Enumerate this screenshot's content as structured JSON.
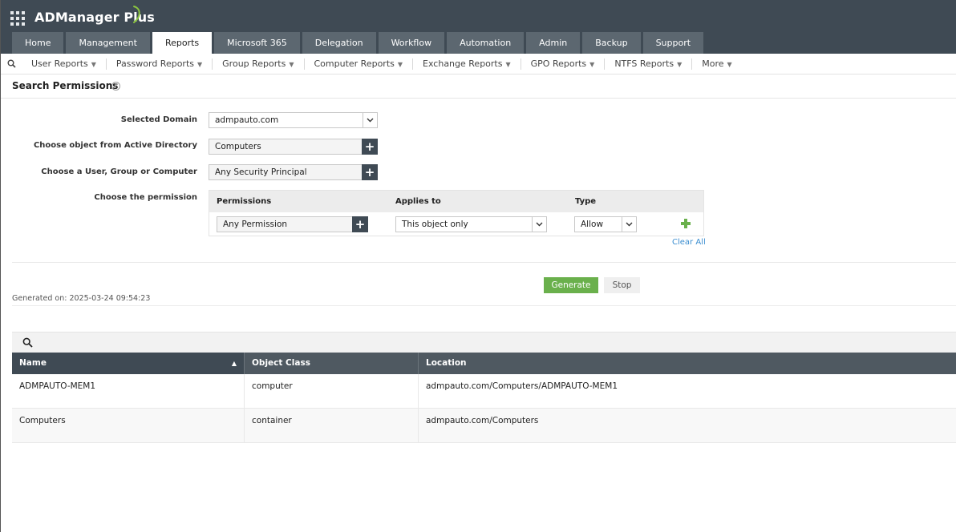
{
  "app": {
    "title": "ADManager Plus",
    "accent_color": "#6ab04c",
    "header_color": "#3f4a54"
  },
  "tabs": [
    {
      "label": "Home"
    },
    {
      "label": "Management"
    },
    {
      "label": "Reports",
      "active": true
    },
    {
      "label": "Microsoft 365"
    },
    {
      "label": "Delegation"
    },
    {
      "label": "Workflow"
    },
    {
      "label": "Automation"
    },
    {
      "label": "Admin"
    },
    {
      "label": "Backup"
    },
    {
      "label": "Support"
    }
  ],
  "submenu": [
    {
      "label": "User Reports"
    },
    {
      "label": "Password Reports"
    },
    {
      "label": "Group Reports"
    },
    {
      "label": "Computer Reports"
    },
    {
      "label": "Exchange Reports"
    },
    {
      "label": "GPO Reports"
    },
    {
      "label": "NTFS Reports"
    },
    {
      "label": "More"
    }
  ],
  "page": {
    "title": "Search Permissions",
    "help_icon": "help-icon"
  },
  "form": {
    "domain_label": "Selected Domain",
    "domain_value": "admpauto.com",
    "object_label": "Choose object from Active Directory",
    "object_value": "Computers",
    "principal_label": "Choose a User, Group or Computer",
    "principal_value": "Any Security Principal",
    "permission_label": "Choose the permission",
    "perm_table": {
      "headers": {
        "permissions": "Permissions",
        "applies_to": "Applies to",
        "type": "Type"
      },
      "row": {
        "permission": "Any Permission",
        "applies_to": "This object only",
        "type": "Allow"
      }
    },
    "clear_all": "Clear All",
    "generate": "Generate",
    "stop": "Stop"
  },
  "generated_on": "Generated on: 2025-03-24 09:54:23",
  "results": {
    "columns": [
      "Name",
      "Object Class",
      "Location"
    ],
    "rows": [
      {
        "name": "ADMPAUTO-MEM1",
        "object_class": "computer",
        "location": "admpauto.com/Computers/ADMPAUTO-MEM1"
      },
      {
        "name": "Computers",
        "object_class": "container",
        "location": "admpauto.com/Computers"
      }
    ]
  }
}
